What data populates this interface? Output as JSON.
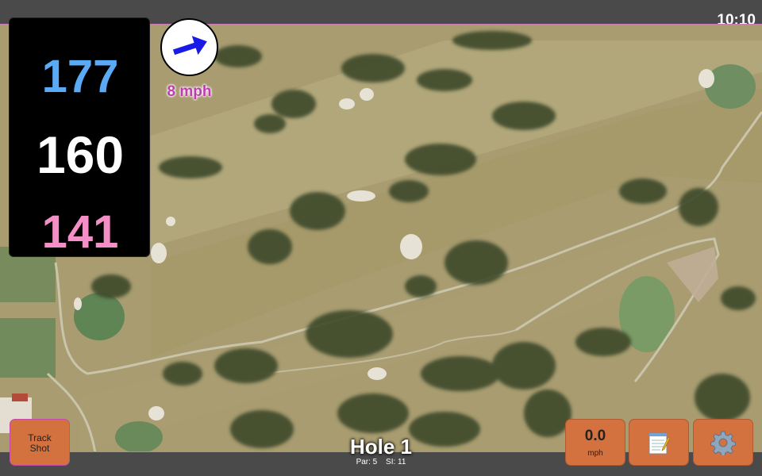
{
  "status": {
    "time": "10:10"
  },
  "distances": {
    "back": "177",
    "middle": "160",
    "front": "141"
  },
  "wind": {
    "speed_label": "8 mph",
    "direction_icon": "wind-arrow-icon"
  },
  "hole": {
    "title": "Hole 1",
    "par": "Par: 5",
    "stroke_index": "SI: 11"
  },
  "buttons": {
    "track_shot_line1": "Track",
    "track_shot_line2": "Shot",
    "speed_value": "0.0",
    "speed_unit": "mph",
    "notes_icon": "notepad-icon",
    "settings_icon": "gear-icon"
  },
  "colors": {
    "back_distance": "#5aaaf5",
    "middle_distance": "#ffffff",
    "front_distance": "#f48ec7",
    "button": "#d3713f",
    "wind_label": "#c13bb0"
  }
}
